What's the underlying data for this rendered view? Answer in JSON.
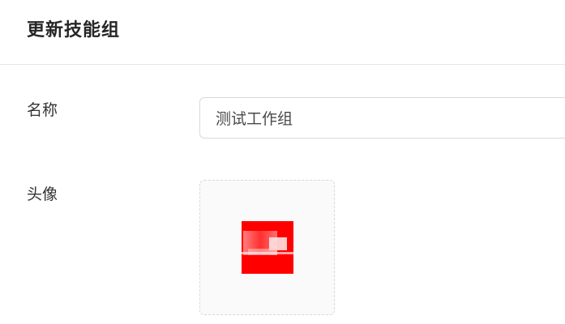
{
  "header": {
    "title": "更新技能组"
  },
  "form": {
    "name_label": "名称",
    "name_value": "测试工作组",
    "avatar_label": "头像"
  },
  "colors": {
    "avatar_fill": "#ff0000",
    "upload_border": "#d9d9d9",
    "upload_bg": "#fafafa"
  }
}
